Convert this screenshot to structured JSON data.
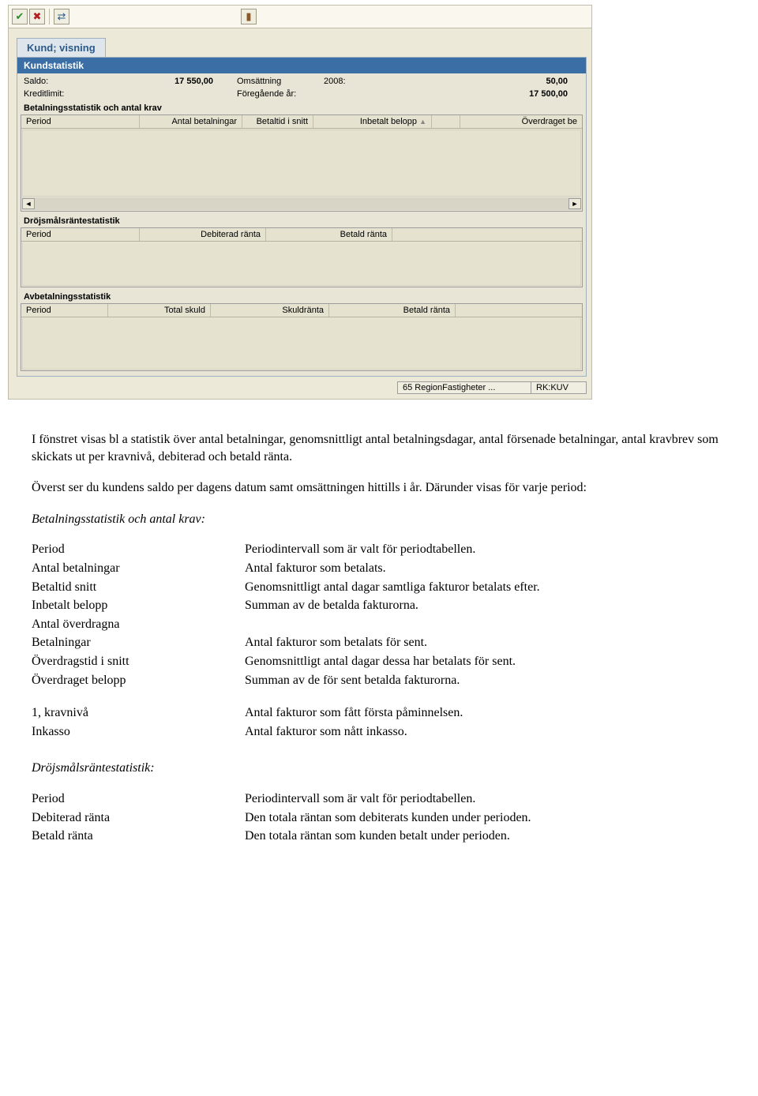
{
  "toolbar": {
    "check_icon": "✔",
    "close_icon": "✖",
    "swap_icon": "⇄",
    "door_icon": "▮"
  },
  "tab_title": "Kund; visning",
  "panel_title": "Kundstatistik",
  "stats": {
    "saldo_label": "Saldo:",
    "saldo_value": "17 550,00",
    "omsattning_label": "Omsättning",
    "year_label": "2008:",
    "year_value": "50,00",
    "kreditlimit_label": "Kreditlimit:",
    "foregaende_label": "Föregående år:",
    "foregaende_value": "17 500,00"
  },
  "section1_title": "Betalningsstatistik och antal krav",
  "grid1": {
    "h1": "Period",
    "h2": "Antal betalningar",
    "h3": "Betaltid i snitt",
    "h4": "Inbetalt belopp",
    "h5": "Överdraget be"
  },
  "section2_title": "Dröjsmålsräntestatistik",
  "grid2": {
    "h1": "Period",
    "h2": "Debiterad ränta",
    "h3": "Betald ränta"
  },
  "section3_title": "Avbetalningsstatistik",
  "grid3": {
    "h1": "Period",
    "h2": "Total skuld",
    "h3": "Skuldränta",
    "h4": "Betald ränta"
  },
  "status": {
    "cell1": "65 RegionFastigheter ...",
    "cell2": "RK:KUV"
  },
  "doc": {
    "p1": "I fönstret visas bl a statistik över antal betalningar, genomsnittligt antal betalningsdagar, antal försenade betalningar, antal kravbrev som skickats ut per kravnivå, debiterad och betald ränta.",
    "p2": "Överst ser du kundens saldo per dagens datum samt omsättningen hittills i år. Därunder visas för varje period:",
    "h1": "Betalningsstatistik och antal krav:",
    "defs1": [
      {
        "t": "Period",
        "d": "Periodintervall som är valt för periodtabellen."
      },
      {
        "t": "Antal betalningar",
        "d": "Antal fakturor som betalats."
      },
      {
        "t": "Betaltid snitt",
        "d": "Genomsnittligt antal dagar samtliga fakturor betalats efter."
      },
      {
        "t": "Inbetalt belopp",
        "d": "Summan av de betalda fakturorna."
      },
      {
        "t": "Antal överdragna",
        "d": ""
      },
      {
        "t": "Betalningar",
        "d": "Antal fakturor som betalats för sent."
      },
      {
        "t": "Överdragstid i snitt",
        "d": "Genomsnittligt antal dagar dessa har betalats för sent."
      },
      {
        "t": "Överdraget belopp",
        "d": "Summan av de för sent betalda fakturorna."
      }
    ],
    "defs2": [
      {
        "t": "1,  kravnivå",
        "d": "Antal fakturor som fått första påminnelsen."
      },
      {
        "t": "Inkasso",
        "d": "Antal fakturor som nått inkasso."
      }
    ],
    "h2": "Dröjsmålsräntestatistik:",
    "defs3": [
      {
        "t": "Period",
        "d": "Periodintervall som är valt  för periodtabellen."
      },
      {
        "t": "Debiterad ränta",
        "d": "Den totala räntan som debiterats kunden under perioden."
      },
      {
        "t": "Betald ränta",
        "d": "Den totala räntan som kunden betalt under perioden."
      }
    ]
  }
}
